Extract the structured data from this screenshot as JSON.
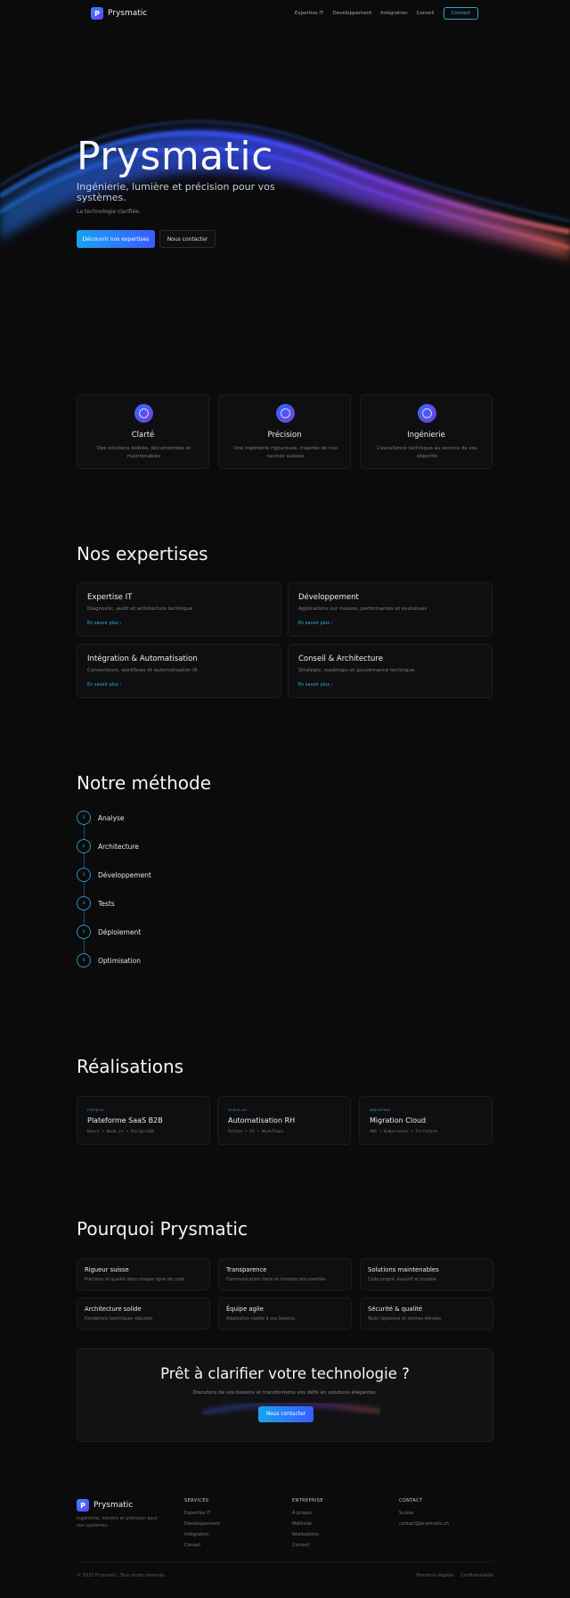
{
  "brand": {
    "logo_letter": "P",
    "name": "Prysmatic"
  },
  "nav": {
    "links": [
      "Expertise IT",
      "Développement",
      "Intégration",
      "Conseil"
    ],
    "contact_label": "Contact"
  },
  "hero": {
    "title": "Prysmatic",
    "subtitle": "Ingénierie, lumière et précision pour vos systèmes.",
    "tagline": "La technologie clarifiée.",
    "primary_cta": "Découvrir nos expertises",
    "secondary_cta": "Nous contacter"
  },
  "values": [
    {
      "title": "Clarté",
      "desc": "Des solutions lisibles, documentées et maintenables"
    },
    {
      "title": "Précision",
      "desc": "Une ingénierie rigoureuse, inspirée de nos racines suisses"
    },
    {
      "title": "Ingénierie",
      "desc": "L'excellence technique au service de vos objectifs"
    }
  ],
  "expertises": {
    "title": "Nos expertises",
    "items": [
      {
        "title": "Expertise IT",
        "desc": "Diagnostic, audit et architecture technique",
        "link": "En savoir plus"
      },
      {
        "title": "Développement",
        "desc": "Applications sur mesure, performantes et évolutives",
        "link": "En savoir plus"
      },
      {
        "title": "Intégration & Automatisation",
        "desc": "Connecteurs, workflows et automatisation IA",
        "link": "En savoir plus"
      },
      {
        "title": "Conseil & Architecture",
        "desc": "Stratégie, roadmaps et gouvernance technique",
        "link": "En savoir plus"
      }
    ]
  },
  "method": {
    "title": "Notre méthode",
    "steps": [
      {
        "num": "1",
        "label": "Analyse"
      },
      {
        "num": "2",
        "label": "Architecture"
      },
      {
        "num": "3",
        "label": "Développement"
      },
      {
        "num": "4",
        "label": "Tests"
      },
      {
        "num": "5",
        "label": "Déploiement"
      },
      {
        "num": "6",
        "label": "Optimisation"
      }
    ]
  },
  "realisations": {
    "title": "Réalisations",
    "items": [
      {
        "category": "FINTECH",
        "title": "Plateforme SaaS B2B",
        "stack": "React • Node.js • PostgreSQL"
      },
      {
        "category": "SCALE-UP",
        "title": "Automatisation RH",
        "stack": "Python • AI • Workflows"
      },
      {
        "category": "INDUSTRIE",
        "title": "Migration Cloud",
        "stack": "AWS • Kubernetes • Terraform"
      }
    ]
  },
  "why": {
    "title": "Pourquoi Prysmatic",
    "items": [
      {
        "title": "Rigueur suisse",
        "desc": "Précision et qualité dans chaque ligne de code"
      },
      {
        "title": "Transparence",
        "desc": "Communication claire et livrables documentés"
      },
      {
        "title": "Solutions maintenables",
        "desc": "Code propre, évolutif et durable"
      },
      {
        "title": "Architecture solide",
        "desc": "Fondations techniques robustes"
      },
      {
        "title": "Équipe agile",
        "desc": "Adaptation rapide à vos besoins"
      },
      {
        "title": "Sécurité & qualité",
        "desc": "Tests rigoureux et normes élevées"
      }
    ]
  },
  "cta": {
    "title": "Prêt à clarifier votre technologie ?",
    "desc": "Discutons de vos besoins et transformons vos défis en solutions élégantes.",
    "button": "Nous contacter"
  },
  "footer": {
    "tagline": "Ingénierie, lumière et précision pour vos systèmes.",
    "services": {
      "head": "SERVICES",
      "items": [
        "Expertise IT",
        "Développement",
        "Intégration",
        "Conseil"
      ]
    },
    "entreprise": {
      "head": "ENTREPRISE",
      "items": [
        "À propos",
        "Méthode",
        "Réalisations",
        "Contact"
      ]
    },
    "contact": {
      "head": "CONTACT",
      "items": [
        "Suisse",
        "contact@prysmatic.ch"
      ]
    },
    "copyright": "© 2025 Prysmatic. Tous droits réservés.",
    "legal": [
      "Mentions légales",
      "Confidentialité"
    ]
  },
  "colors": {
    "accent": "#16a3f0",
    "accent2": "#3b5cff",
    "background": "#0b0b0c",
    "link": "#2fb0e8"
  }
}
